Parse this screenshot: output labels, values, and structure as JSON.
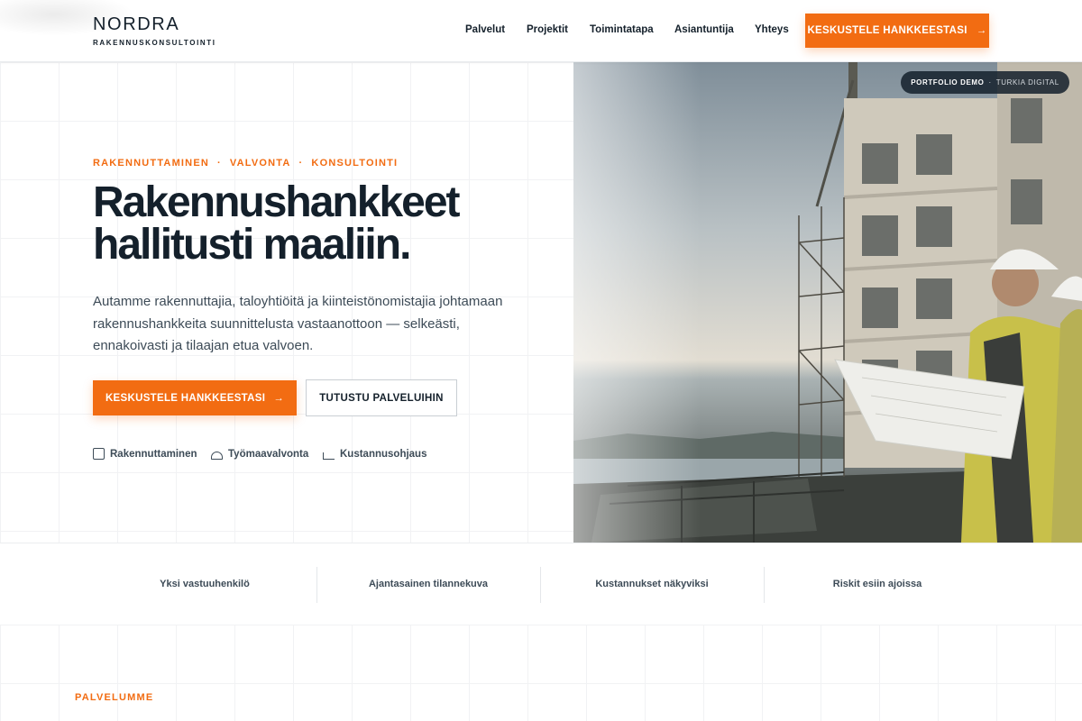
{
  "brand": {
    "name": "NORDRA",
    "tagline": "RAKENNUSKONSULTOINTI"
  },
  "nav": {
    "links": [
      {
        "label": "Palvelut"
      },
      {
        "label": "Projektit"
      },
      {
        "label": "Toimintatapa"
      },
      {
        "label": "Asiantuntija"
      },
      {
        "label": "Yhteys"
      }
    ],
    "cta_label": "KESKUSTELE HANKKEESTASI",
    "cta_arrow": "→"
  },
  "hero": {
    "eyebrow": [
      "RAKENNUTTAMINEN",
      "VALVONTA",
      "KONSULTOINTI"
    ],
    "eyebrow_separator": "·",
    "headline_line1": "Rakennushankkeet",
    "headline_line2": "hallitusti maaliin.",
    "lead": "Autamme rakennuttajia, taloyhtiöitä ja kiinteistönomistajia johtamaan rakennushankkeita suunnittelusta vastaanottoon — selkeästi, ennakoivasti ja tilaajan etua valvoen.",
    "primary_button": "KESKUSTELE HANKKEESTASI",
    "primary_arrow": "→",
    "secondary_button": "TUTUSTU PALVELUIHIN",
    "features": [
      {
        "label": "Rakennuttaminen",
        "icon": "checkbox-icon"
      },
      {
        "label": "Työmaavalvonta",
        "icon": "hard-hat-icon"
      },
      {
        "label": "Kustannusohjaus",
        "icon": "chart-corner-icon"
      }
    ]
  },
  "badge": {
    "strong": "PORTFOLIO DEMO",
    "separator": "·",
    "light": "TURKIA DIGITAL"
  },
  "stats": [
    {
      "label": "Yksi vastuuhenkilö"
    },
    {
      "label": "Ajantasainen tilannekuva"
    },
    {
      "label": "Kustannukset näkyviksi"
    },
    {
      "label": "Riskit esiin ajoissa"
    }
  ],
  "section": {
    "eyebrow": "PALVELUMME"
  },
  "colors": {
    "accent": "#f26c12",
    "ink": "#14202b",
    "muted": "#3d4b57"
  }
}
